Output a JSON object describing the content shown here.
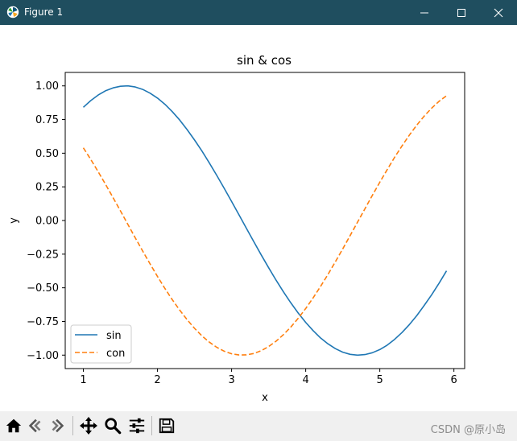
{
  "window": {
    "title": "Figure 1",
    "minimize_icon": "minimize-icon",
    "maximize_icon": "maximize-icon",
    "close_icon": "close-icon",
    "titlebar_color": "#1f4e5f"
  },
  "chart_data": {
    "type": "line",
    "title": "sin & cos",
    "xlabel": "x",
    "ylabel": "y",
    "xlim": [
      0.755,
      6.145
    ],
    "ylim": [
      -1.1,
      1.1
    ],
    "xticks": [
      1,
      2,
      3,
      4,
      5,
      6
    ],
    "yticks": [
      1.0,
      0.75,
      0.5,
      0.25,
      0.0,
      -0.25,
      -0.5,
      -0.75,
      -1.0
    ],
    "xtick_labels": [
      "1",
      "2",
      "3",
      "4",
      "5",
      "6"
    ],
    "ytick_labels": [
      "1.00",
      "0.75",
      "0.50",
      "0.25",
      "0.00",
      "−0.25",
      "−0.50",
      "−0.75",
      "−1.00"
    ],
    "grid": false,
    "legend_position": "lower-left",
    "x": [
      1.0,
      1.1,
      1.2,
      1.3,
      1.4,
      1.5,
      1.6,
      1.7,
      1.8,
      1.9,
      2.0,
      2.1,
      2.2,
      2.3,
      2.4,
      2.5,
      2.6,
      2.7,
      2.8,
      2.9,
      3.0,
      3.1,
      3.2,
      3.3,
      3.4,
      3.5,
      3.6,
      3.7,
      3.8,
      3.9,
      4.0,
      4.1,
      4.2,
      4.3,
      4.4,
      4.5,
      4.6,
      4.7,
      4.8,
      4.9,
      5.0,
      5.1,
      5.2,
      5.3,
      5.4,
      5.5,
      5.6,
      5.7,
      5.8,
      5.9
    ],
    "series": [
      {
        "name": "sin",
        "color": "#1f77b4",
        "style": "solid",
        "values": [
          0.841,
          0.891,
          0.932,
          0.964,
          0.985,
          0.997,
          1.0,
          0.992,
          0.974,
          0.946,
          0.909,
          0.863,
          0.808,
          0.746,
          0.675,
          0.598,
          0.516,
          0.427,
          0.335,
          0.239,
          0.141,
          0.042,
          -0.058,
          -0.158,
          -0.256,
          -0.351,
          -0.443,
          -0.53,
          -0.612,
          -0.688,
          -0.757,
          -0.818,
          -0.872,
          -0.916,
          -0.952,
          -0.978,
          -0.994,
          -1.0,
          -0.996,
          -0.982,
          -0.959,
          -0.926,
          -0.883,
          -0.832,
          -0.773,
          -0.706,
          -0.631,
          -0.551,
          -0.465,
          -0.374
        ]
      },
      {
        "name": "con",
        "color": "#ff7f0e",
        "style": "dashed",
        "values": [
          0.54,
          0.454,
          0.362,
          0.267,
          0.17,
          0.071,
          -0.029,
          -0.129,
          -0.227,
          -0.323,
          -0.416,
          -0.505,
          -0.589,
          -0.666,
          -0.737,
          -0.801,
          -0.857,
          -0.904,
          -0.942,
          -0.971,
          -0.99,
          -0.999,
          -0.998,
          -0.988,
          -0.967,
          -0.936,
          -0.897,
          -0.848,
          -0.791,
          -0.726,
          -0.654,
          -0.575,
          -0.49,
          -0.401,
          -0.307,
          -0.211,
          -0.112,
          -0.012,
          0.087,
          0.187,
          0.284,
          0.378,
          0.469,
          0.554,
          0.635,
          0.709,
          0.776,
          0.835,
          0.886,
          0.927
        ]
      }
    ]
  },
  "toolbar": {
    "home_icon": "home-icon",
    "back_icon": "back-icon",
    "forward_icon": "forward-icon",
    "pan_icon": "pan-icon",
    "zoom_icon": "zoom-icon",
    "configure_icon": "configure-subplots-icon",
    "save_icon": "save-icon"
  },
  "watermark": "CSDN @原小岛"
}
